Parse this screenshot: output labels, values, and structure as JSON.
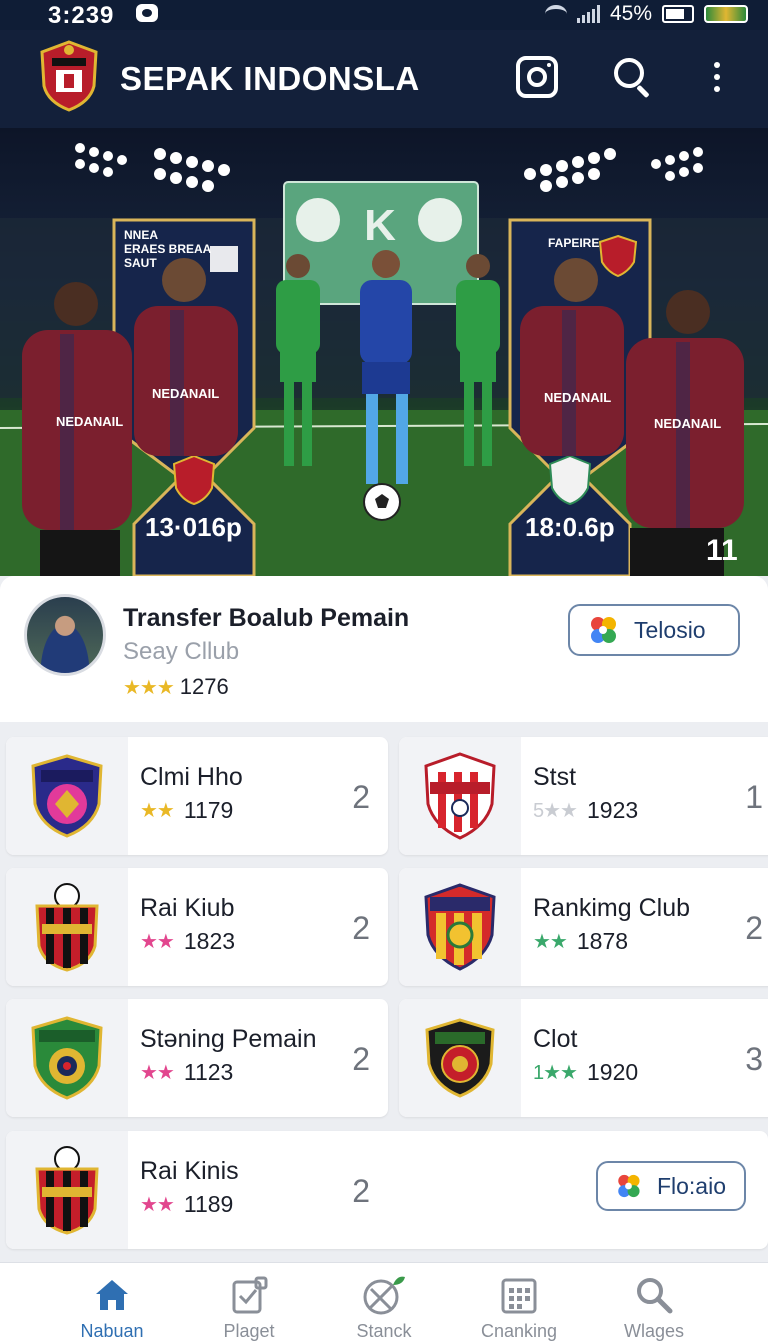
{
  "status_bar": {
    "time": "3:239",
    "battery": "45%"
  },
  "app_bar": {
    "title": "SEPAK INDONSLA"
  },
  "hero": {
    "left_panel_text": [
      "NNEA",
      "ERAES BREAA",
      "SAUT"
    ],
    "right_panel_text": "FAPEIRE",
    "left_score": "13·016p",
    "right_score": "18:0.6p",
    "jersey_text": "NEDANAIL",
    "jersey_number": "11"
  },
  "profile": {
    "title": "Transfer Boalub Pemain",
    "subtitle": "Seay Cllub",
    "stars": "★★★",
    "rating": "1276",
    "button_label": "Telosio"
  },
  "clubs": [
    {
      "name": "Clmi Hho",
      "stars": "★★",
      "rating": "1179",
      "rank": "2",
      "star_color": "#e9b826"
    },
    {
      "name": "Stst",
      "stars": "5★★",
      "rating": "1923",
      "rank": "1",
      "star_color": "#c9ccd2"
    },
    {
      "name": "Rai Kiub",
      "stars": "★★",
      "rating": "1823",
      "rank": "2",
      "star_color": "#e2468e"
    },
    {
      "name": "Rankimg Club",
      "stars": "★★",
      "rating": "1878",
      "rank": "2",
      "star_color": "#3aa86b"
    },
    {
      "name": "Stǝning Pemain",
      "stars": "★★",
      "rating": "1123",
      "rank": "2",
      "star_color": "#e2468e"
    },
    {
      "name": "Clot",
      "stars": "1★★",
      "rating": "1920",
      "rank": "3",
      "star_color": "#3aa86b"
    },
    {
      "name": "Rai Kinis",
      "stars": "★★",
      "rating": "1189",
      "rank": "2",
      "star_color": "#e2468e",
      "button_label": "Flo:aio"
    }
  ],
  "bottom_nav": [
    {
      "label": "Nabuan",
      "icon": "home-icon",
      "active": true
    },
    {
      "label": "Plaget",
      "icon": "clipboard-icon",
      "active": false
    },
    {
      "label": "Stanck",
      "icon": "ball-icon",
      "active": false
    },
    {
      "label": "Cnanking",
      "icon": "calendar-icon",
      "active": false
    },
    {
      "label": "Wlages",
      "icon": "search-icon",
      "active": false
    }
  ],
  "colors": {
    "header": "#13203a",
    "accent": "#2f6fb2"
  }
}
